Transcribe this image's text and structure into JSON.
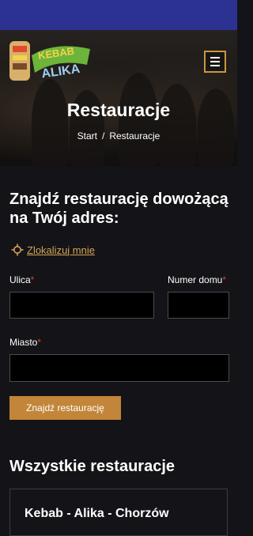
{
  "header": {
    "logo_text": "Kebab Alika",
    "title": "Restauracje",
    "breadcrumb": {
      "home": "Start",
      "separator": "/",
      "current": "Restauracje"
    }
  },
  "search": {
    "heading": "Znajdź restaurację dowożącą na Twój adres:",
    "locate_label": "Zlokalizuj mnie",
    "street_label": "Ulica",
    "house_label": "Numer domu",
    "city_label": "Miasto",
    "required_mark": "*",
    "submit_label": "Znajdź restaurację"
  },
  "restaurants": {
    "heading": "Wszystkie restauracje",
    "first_card_title": "Kebab - Alika - Chorzów"
  },
  "colors": {
    "status_bar": "#2b3291",
    "background": "#141418",
    "accent": "#c2853a",
    "link": "#d3a455",
    "required": "#e03a2f"
  }
}
